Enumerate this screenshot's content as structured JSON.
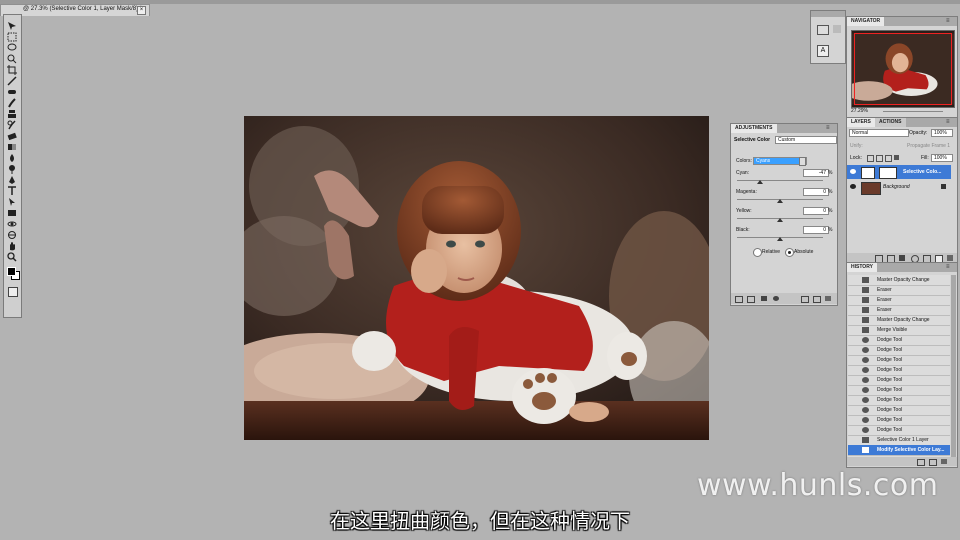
{
  "document": {
    "tab_title": "@ 27.3% (Selective Color 1, Layer Mask/8) *",
    "close_glyph": "×"
  },
  "toolbox": {
    "tools": [
      "move-tool",
      "marquee-tool",
      "lasso-tool",
      "quick-select-tool",
      "crop-tool",
      "eyedropper-tool",
      "healing-brush-tool",
      "brush-tool",
      "clone-stamp-tool",
      "history-brush-tool",
      "eraser-tool",
      "gradient-tool",
      "blur-tool",
      "dodge-tool",
      "pen-tool",
      "type-tool",
      "path-select-tool",
      "shape-tool",
      "3d-rotate-tool",
      "3d-orbit-tool",
      "hand-tool",
      "zoom-tool"
    ]
  },
  "navigator": {
    "tab": "NAVIGATOR",
    "zoom": "27.29%"
  },
  "layers": {
    "tabs": [
      "LAYERS",
      "ACTIONS"
    ],
    "blend_mode": "Normal",
    "opacity_label": "Opacity:",
    "opacity": "100%",
    "unify_label": "Unify:",
    "propagate_label": "Propagate Frame 1",
    "lock_label": "Lock:",
    "fill_label": "Fill:",
    "fill": "100%",
    "items": [
      {
        "name": "Selective Colo...",
        "selected": true
      },
      {
        "name": "Background",
        "selected": false
      }
    ]
  },
  "adjustments": {
    "tab": "ADJUSTMENTS",
    "title": "Selective Color",
    "preset": "Custom",
    "colors_label": "Colors:",
    "colors_value": "Cyans",
    "sliders": [
      {
        "label": "Cyan:",
        "value": "-47",
        "unit": "%",
        "level": 0.265
      },
      {
        "label": "Magenta:",
        "value": "0",
        "unit": "%",
        "level": 0.5
      },
      {
        "label": "Yellow:",
        "value": "0",
        "unit": "%",
        "level": 0.5
      },
      {
        "label": "Black:",
        "value": "0",
        "unit": "%",
        "level": 0.5
      }
    ],
    "method_relative": "Relative",
    "method_absolute": "Absolute",
    "method_selected": "Absolute"
  },
  "history": {
    "tab": "HISTORY",
    "items": [
      {
        "label": "Master Opacity Change",
        "icon": "history-step-icon"
      },
      {
        "label": "Eraser",
        "icon": "eraser-icon"
      },
      {
        "label": "Eraser",
        "icon": "eraser-icon"
      },
      {
        "label": "Eraser",
        "icon": "eraser-icon"
      },
      {
        "label": "Master Opacity Change",
        "icon": "history-step-icon"
      },
      {
        "label": "Merge Visible",
        "icon": "history-step-icon"
      },
      {
        "label": "Dodge Tool",
        "icon": "dodge-icon"
      },
      {
        "label": "Dodge Tool",
        "icon": "dodge-icon"
      },
      {
        "label": "Dodge Tool",
        "icon": "dodge-icon"
      },
      {
        "label": "Dodge Tool",
        "icon": "dodge-icon"
      },
      {
        "label": "Dodge Tool",
        "icon": "dodge-icon"
      },
      {
        "label": "Dodge Tool",
        "icon": "dodge-icon"
      },
      {
        "label": "Dodge Tool",
        "icon": "dodge-icon"
      },
      {
        "label": "Dodge Tool",
        "icon": "dodge-icon"
      },
      {
        "label": "Dodge Tool",
        "icon": "dodge-icon"
      },
      {
        "label": "Dodge Tool",
        "icon": "dodge-icon"
      },
      {
        "label": "Selective Color 1 Layer",
        "icon": "history-step-icon"
      },
      {
        "label": "Modify Selective Color Lay...",
        "icon": "history-step-icon",
        "selected": true
      }
    ]
  },
  "subtitle": "在这里扭曲颜色，但在这种情况下",
  "watermark": "www.hunls.com",
  "colors": {
    "accent": "#3d7ad6",
    "workspace": "#b3b3b3",
    "panel": "#d4d4d4"
  }
}
